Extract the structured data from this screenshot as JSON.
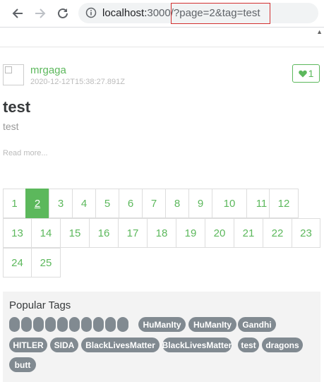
{
  "browser": {
    "url_host": "localhost:",
    "url_port_path": "3000/",
    "url_query": "?page=2&tag=test"
  },
  "article": {
    "author": "mrgaga",
    "date": "2020-12-12T15:38:27.891Z",
    "favorites": "1",
    "title": "test",
    "description": "test",
    "read_more": "Read more..."
  },
  "pagination": {
    "pages": [
      "1",
      "2",
      "3",
      "4",
      "5",
      "6",
      "7",
      "8",
      "9",
      "10",
      "11",
      "12",
      "13",
      "14",
      "15",
      "16",
      "17",
      "18",
      "19",
      "20",
      "21",
      "22",
      "23",
      "24",
      "25"
    ],
    "active": "2"
  },
  "sidebar": {
    "title": "Popular Tags",
    "tags": [
      "",
      "",
      "",
      "",
      "",
      "",
      "",
      "",
      "",
      "",
      "HuManIty",
      "HuManIty",
      "Gandhi",
      "HITLER",
      "SIDA",
      "BlackLivesMatter",
      "BlackLivesMatter",
      "test",
      "dragons",
      "butt"
    ]
  },
  "colors": {
    "accent": "#5cb85c",
    "tag_bg": "#818a91",
    "highlight_box": "#d32f2f"
  }
}
